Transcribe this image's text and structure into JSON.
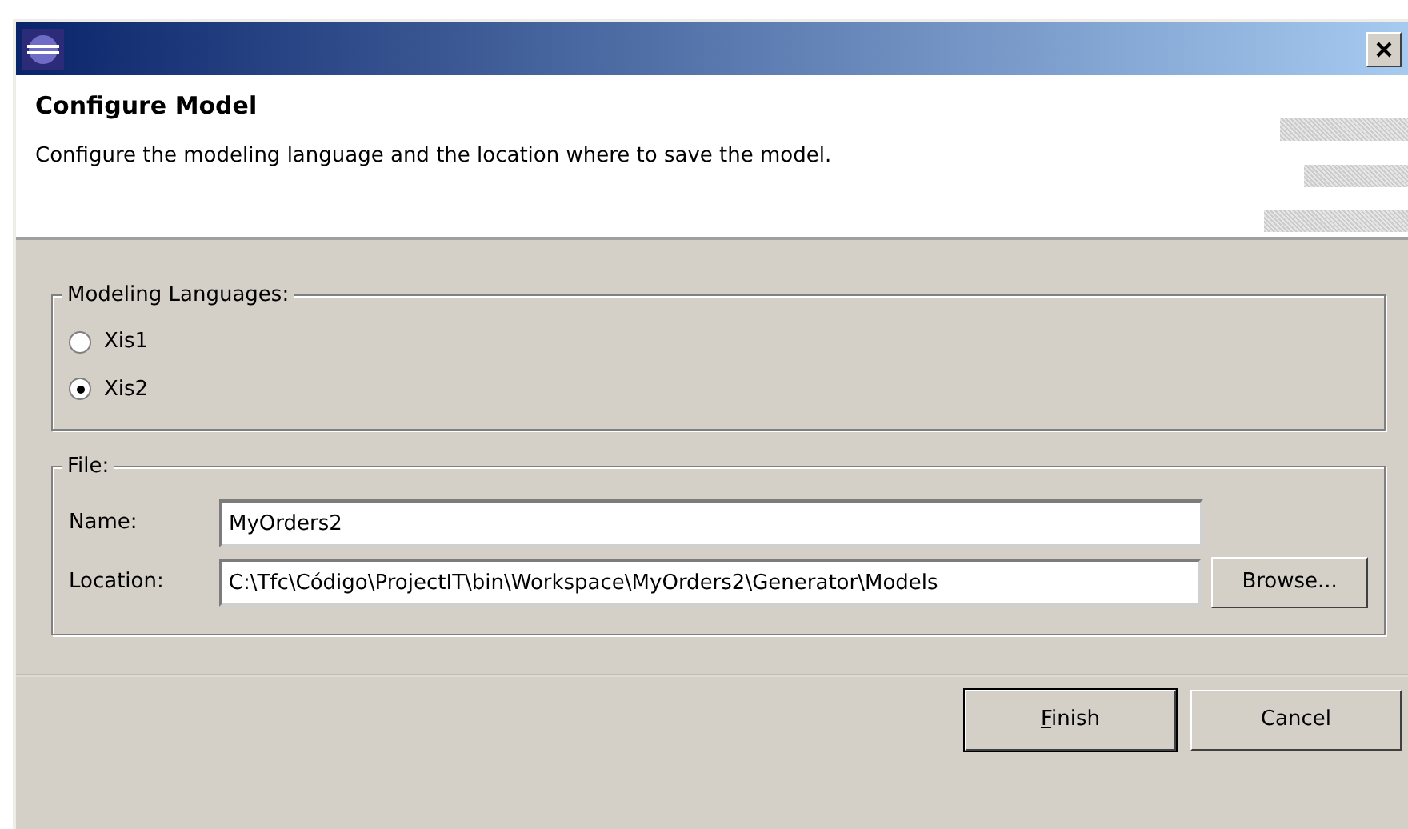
{
  "banner": {
    "title": "Configure Model",
    "description": "Configure the modeling language and the location where to save the model."
  },
  "languages": {
    "legend": "Modeling Languages:",
    "options": [
      {
        "label": "Xis1",
        "selected": false
      },
      {
        "label": "Xis2",
        "selected": true
      }
    ]
  },
  "file": {
    "legend": "File:",
    "fields": [
      {
        "label": "Name:",
        "value": "MyOrders2"
      },
      {
        "label": "Location:",
        "value": "C:\\Tfc\\Código\\ProjectIT\\bin\\Workspace\\MyOrders2\\Generator\\Models",
        "button": "Browse..."
      }
    ]
  },
  "buttons": [
    {
      "label": "Finish",
      "default": true,
      "mnemonic": true
    },
    {
      "label": "Cancel",
      "default": false,
      "mnemonic": false
    }
  ]
}
